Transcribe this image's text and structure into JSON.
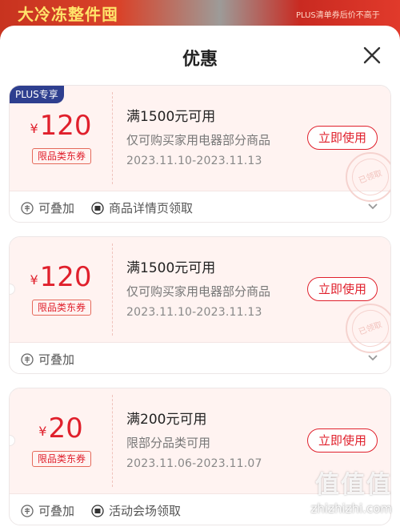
{
  "background": {
    "banner_text": "大冷冻整件囤",
    "plus_note": "PLUS清单券后价不高于"
  },
  "sheet": {
    "title": "优惠"
  },
  "coupons": [
    {
      "plus_tag": "PLUS专享",
      "currency": "¥",
      "amount": "120",
      "limit_tag": "限品类东券",
      "condition": "满1500元可用",
      "scope": "仅可购买家用电器部分商品",
      "date_range": "2023.11.10-2023.11.13",
      "button": "立即使用",
      "stamp": "已领取",
      "stackable": "可叠加",
      "source": "商品详情页领取"
    },
    {
      "currency": "¥",
      "amount": "120",
      "limit_tag": "限品类东券",
      "condition": "满1500元可用",
      "scope": "仅可购买家用电器部分商品",
      "date_range": "2023.11.10-2023.11.13",
      "button": "立即使用",
      "stamp": "已领取",
      "stackable": "可叠加"
    },
    {
      "currency": "¥",
      "amount": "20",
      "limit_tag": "限品类东券",
      "condition": "满200元可用",
      "scope": "限部分品类可用",
      "date_range": "2023.11.06-2023.11.07",
      "button": "立即使用",
      "stackable": "可叠加",
      "source": "活动会场领取"
    }
  ],
  "watermark": {
    "logo": "值值值",
    "site": "zhizhizhi.com"
  },
  "colors": {
    "accent": "#e0202c",
    "coupon_bg": "#fff3f1",
    "plus_tag": "#2e3f8f"
  },
  "icons": {
    "close": "close-icon",
    "stack": "stack-icon",
    "source": "tag-icon",
    "expand": "chevron-down-icon"
  }
}
